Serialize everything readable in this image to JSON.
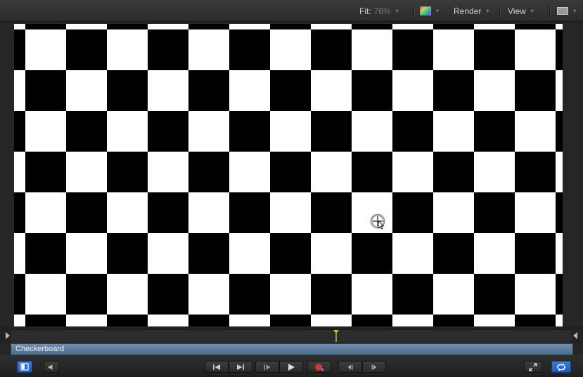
{
  "toolbar": {
    "fit_label": "Fit:",
    "fit_value": "76%",
    "color_channels_icon": "color-swatch-icon",
    "render_label": "Render",
    "view_label": "View",
    "layout_icon": "viewer-layout-icon"
  },
  "canvas": {
    "pattern": "checkerboard",
    "colors": {
      "dark": "#000000",
      "light": "#ffffff"
    }
  },
  "timeline": {
    "clip_name": "Checkerboard",
    "clip_color": "#5b7a99"
  },
  "transport": {
    "buttons": [
      "toggle-timing-icon",
      "audio-icon",
      "go-to-start-icon",
      "go-to-end-icon",
      "play-from-start-icon",
      "play-icon",
      "record-icon",
      "previous-frame-icon",
      "next-frame-icon",
      "fullscreen-icon",
      "loop-playback-icon"
    ]
  },
  "colors": {
    "accent_blue": "#2a6bd0",
    "record_red": "#c93a3a",
    "playhead": "#b7c44a"
  }
}
